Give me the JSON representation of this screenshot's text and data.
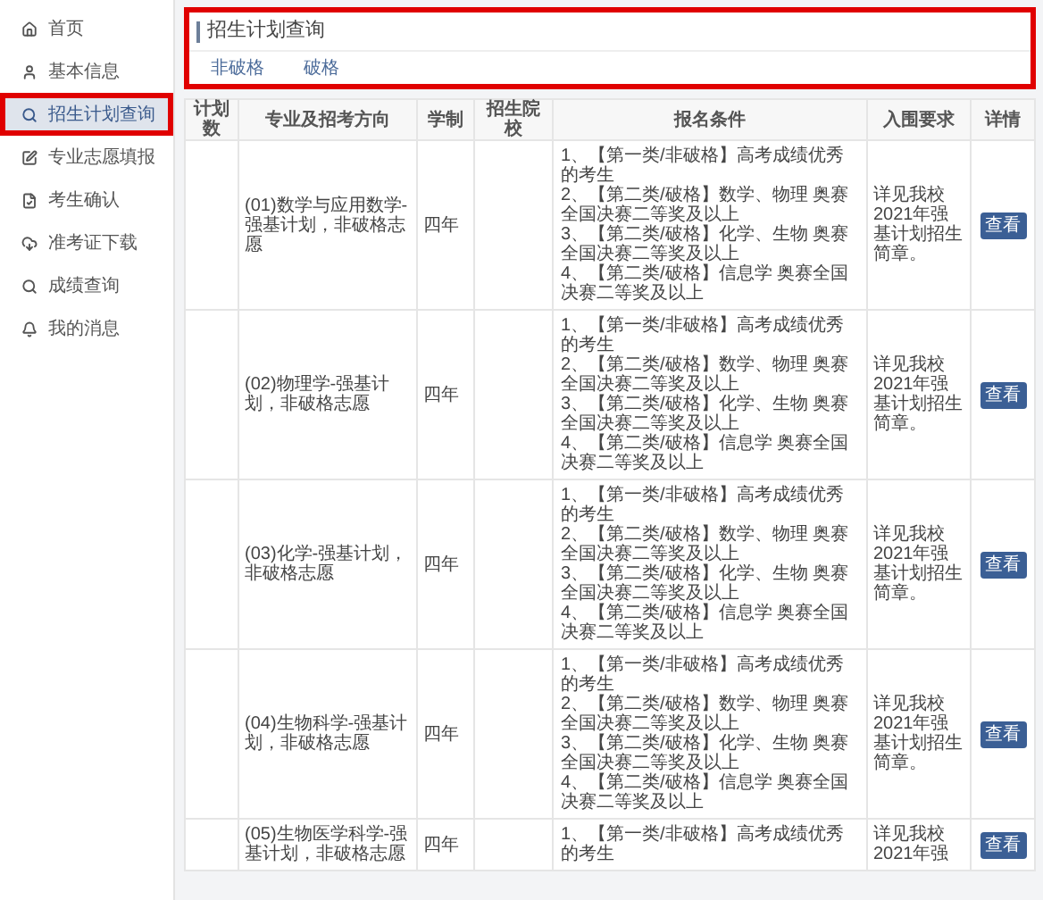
{
  "sidebar": {
    "items": [
      {
        "label": "首页",
        "selected": false,
        "annotated": false
      },
      {
        "label": "基本信息",
        "selected": false,
        "annotated": false
      },
      {
        "label": "招生计划查询",
        "selected": true,
        "annotated": true
      },
      {
        "label": "专业志愿填报",
        "selected": false,
        "annotated": false
      },
      {
        "label": "考生确认",
        "selected": false,
        "annotated": false
      },
      {
        "label": "准考证下载",
        "selected": false,
        "annotated": false
      },
      {
        "label": "成绩查询",
        "selected": false,
        "annotated": false
      },
      {
        "label": "我的消息",
        "selected": false,
        "annotated": false
      }
    ]
  },
  "header": {
    "title": "招生计划查询",
    "annotated": true,
    "tabs": [
      "非破格",
      "破格"
    ]
  },
  "table": {
    "columns": [
      "计划数",
      "专业及招考方向",
      "学制",
      "招生院校",
      "报名条件",
      "入围要求",
      "详情"
    ],
    "rows": [
      {
        "major": "(01)数学与应用数学-强基计划，非破格志愿",
        "length": "四年",
        "conditions": [
          "1、【第一类/非破格】高考成绩优秀的考生",
          "2、【第二类/破格】数学、物理 奥赛全国决赛二等奖及以上",
          "3、【第二类/破格】化学、生物 奥赛全国决赛二等奖及以上",
          "4、【第二类/破格】信息学 奥赛全国决赛二等奖及以上"
        ],
        "requirement": "详见我校2021年强基计划招生简章。",
        "action": "查看"
      },
      {
        "major": "(02)物理学-强基计划，非破格志愿",
        "length": "四年",
        "conditions": [
          "1、【第一类/非破格】高考成绩优秀的考生",
          "2、【第二类/破格】数学、物理 奥赛全国决赛二等奖及以上",
          "3、【第二类/破格】化学、生物 奥赛全国决赛二等奖及以上",
          "4、【第二类/破格】信息学 奥赛全国决赛二等奖及以上"
        ],
        "requirement": "详见我校2021年强基计划招生简章。",
        "action": "查看"
      },
      {
        "major": "(03)化学-强基计划，非破格志愿",
        "length": "四年",
        "conditions": [
          "1、【第一类/非破格】高考成绩优秀的考生",
          "2、【第二类/破格】数学、物理 奥赛全国决赛二等奖及以上",
          "3、【第二类/破格】化学、生物 奥赛全国决赛二等奖及以上",
          "4、【第二类/破格】信息学 奥赛全国决赛二等奖及以上"
        ],
        "requirement": "详见我校2021年强基计划招生简章。",
        "action": "查看"
      },
      {
        "major": "(04)生物科学-强基计划，非破格志愿",
        "length": "四年",
        "conditions": [
          "1、【第一类/非破格】高考成绩优秀的考生",
          "2、【第二类/破格】数学、物理 奥赛全国决赛二等奖及以上",
          "3、【第二类/破格】化学、生物 奥赛全国决赛二等奖及以上",
          "4、【第二类/破格】信息学 奥赛全国决赛二等奖及以上"
        ],
        "requirement": "详见我校2021年强基计划招生简章。",
        "action": "查看"
      },
      {
        "major": "(05)生物医学科学-强基计划，非破格志愿",
        "length": "四年",
        "conditions": [
          "1、【第一类/非破格】高考成绩优秀的考生"
        ],
        "requirement": "详见我校2021年强",
        "action": "查看"
      }
    ]
  }
}
